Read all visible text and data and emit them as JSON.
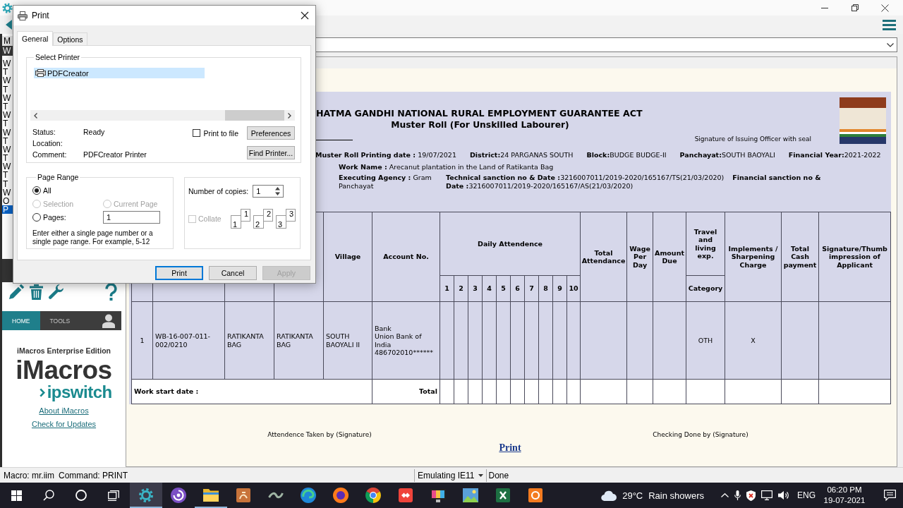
{
  "print_dialog": {
    "title": "Print",
    "tabs": [
      {
        "label": "General",
        "selected": true
      },
      {
        "label": "Options",
        "selected": false
      }
    ],
    "select_printer": {
      "legend": "Select Printer",
      "printers": [
        {
          "name": "PDFCreator",
          "selected": true
        }
      ]
    },
    "printer_info": [
      {
        "label": "Status:",
        "value": "Ready"
      },
      {
        "label": "Location:"
      },
      {
        "label": "Comment:",
        "value": "PDFCreator Printer"
      }
    ],
    "print_to_file": {
      "label": "Print to file",
      "checked": false
    },
    "side_buttons": [
      "Preferences",
      "Find Printer..."
    ],
    "page_range": {
      "legend": "Page Range",
      "options": [
        {
          "label": "All",
          "selected": true,
          "disabled": false
        },
        {
          "label": "Selection",
          "selected": false,
          "disabled": true
        },
        {
          "label": "Current Page",
          "selected": false,
          "disabled": true
        },
        {
          "label": "Pages:",
          "selected": false,
          "disabled": false
        }
      ],
      "pages_value": "1",
      "hint": "Enter either a single page number or a single page range. For example, 5-12"
    },
    "copies": {
      "label": "Number of copies:",
      "value": "1",
      "collate": {
        "label": "Collate",
        "checked": false,
        "disabled": true
      },
      "collate_sample": [
        [
          "1",
          "1"
        ],
        [
          "2",
          "2"
        ],
        [
          "3",
          "3"
        ]
      ]
    },
    "buttons": [
      {
        "label": "Print",
        "default": true,
        "disabled": false
      },
      {
        "label": "Cancel",
        "default": false,
        "disabled": false
      },
      {
        "label": "Apply",
        "default": false,
        "disabled": true
      }
    ]
  },
  "sidebar": {
    "panel_title": "M",
    "list_heading": "W",
    "macros": [
      {
        "label": "W",
        "selected": false
      },
      {
        "label": "T",
        "selected": false
      },
      {
        "label": "W",
        "selected": false
      },
      {
        "label": "T",
        "selected": false
      },
      {
        "label": "W",
        "selected": false
      },
      {
        "label": "T",
        "selected": false
      },
      {
        "label": "W",
        "selected": false
      },
      {
        "label": "T",
        "selected": false
      },
      {
        "label": "W",
        "selected": false
      },
      {
        "label": "T",
        "selected": false
      },
      {
        "label": "W",
        "selected": false
      },
      {
        "label": "T",
        "selected": false
      },
      {
        "label": "W",
        "selected": false
      },
      {
        "label": "T",
        "selected": false
      },
      {
        "label": "T",
        "selected": false
      },
      {
        "label": "W",
        "selected": false
      },
      {
        "label": "O",
        "selected": false
      },
      {
        "label": "P",
        "selected": true
      }
    ],
    "tabs": [
      {
        "label": "HOME",
        "selected": true
      },
      {
        "label": "TOOLS",
        "selected": false
      }
    ],
    "edition": "iMacros Enterprise Edition",
    "logo": {
      "product": "iMacros",
      "company": "ipswitch"
    },
    "links": [
      "About iMacros",
      "Check for Updates"
    ]
  },
  "page": {
    "header": {
      "title": "HATMA GANDHI NATIONAL RURAL EMPLOYMENT GUARANTEE ACT",
      "subtitle": "Muster Roll (For Unskilled Labourer)",
      "signature_note": "Signature of Issuing Officer with seal",
      "info": [
        "**Muster Roll Printing date :** 19/07/2021",
        "**District:**24 PARGANAS SOUTH",
        "**Block:**BUDGE BUDGE-II",
        "**Panchayat:**SOUTH BAOYALI",
        "**Financial Year:**2021-2022"
      ],
      "work_name": "**Work Name :** Arecanut plantation in the Land of Ratikanta Bag",
      "executing_agency": "**Executing Agency :** Gram Panchayat",
      "technical_sanction": "**Technical sanction no & Date :**3216007011/2019-2020/165167/TS(21/03/2020)",
      "financial_sanction": "**Financial sanction no & Date :**3216007011/2019-2020/165167/AS(21/03/2020)"
    },
    "table": {
      "head": {
        "village": "Village",
        "account_no": "Account No.",
        "daily_attendance": "Daily Attendence",
        "days": [
          "1",
          "2",
          "3",
          "4",
          "5",
          "6",
          "7",
          "8",
          "9",
          "10"
        ],
        "total_attendance": "Total Attendance",
        "wage_per_day": "Wage Per Day",
        "amount_due": "Amount Due",
        "travel": "Travel and living exp.",
        "category": "Category",
        "implements": "Implements / Sharpening Charge",
        "total_cash": "Total Cash payment",
        "signature": "Signature/Thumb impression of Applicant"
      },
      "rows": [
        {
          "column_1": "1",
          "column_2": "WB-16-007-011-002/0210",
          "column_3": "RATIKANTA BAG",
          "column_4": "RATIKANTA BAG",
          "village": "SOUTH BAOYALI II",
          "account_no": [
            "Bank",
            "Union Bank of India",
            "486702010******"
          ],
          "category": "OTH",
          "implements": "X"
        }
      ],
      "total_row": {
        "label": "Work start date :",
        "total": "Total"
      }
    },
    "footer": {
      "attendance_signature": "Attendence Taken by (Signature)",
      "checking_signature": "Checking Done by (Signature)",
      "print_link": "Print"
    }
  },
  "status_bar": {
    "macro": "Macro: mr.iim",
    "command": "Command: PRINT",
    "mode": "Emulating IE11",
    "state": "Done"
  },
  "taskbar": {
    "apps": [
      {
        "selected": true,
        "running": true
      },
      {
        "selected": false,
        "running": false
      },
      {
        "selected": false,
        "running": true
      },
      {
        "selected": false,
        "running": false
      },
      {
        "selected": false,
        "running": false
      },
      {
        "selected": false,
        "running": false
      },
      {
        "selected": false,
        "running": false
      },
      {
        "selected": false,
        "running": false
      },
      {
        "selected": false,
        "running": false
      },
      {
        "selected": false,
        "running": false
      },
      {
        "selected": false,
        "running": false
      },
      {
        "selected": false,
        "running": false
      },
      {
        "selected": false,
        "running": false
      }
    ],
    "weather": {
      "temperature": "29°C",
      "condition": "Rain showers"
    },
    "language": "ENG",
    "time": "06:20 PM",
    "date": "19-07-2021"
  }
}
